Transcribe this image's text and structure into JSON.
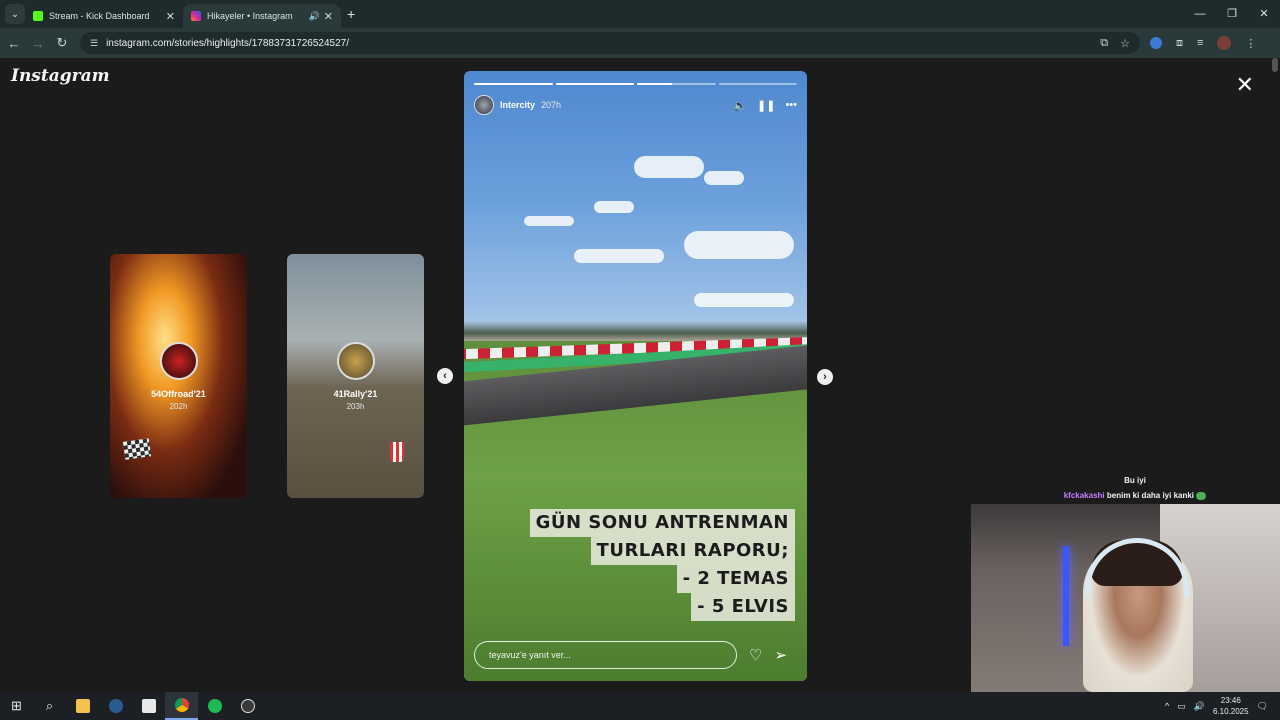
{
  "browser": {
    "tabs": [
      {
        "title": "Stream - Kick Dashboard",
        "favicon_color": "#53fc18",
        "active": false
      },
      {
        "title": "Hikayeler • Instagram",
        "favicon_color": "#d6249f",
        "active": true
      }
    ],
    "url": "instagram.com/stories/highlights/17883731726524527/",
    "window_controls": [
      "—",
      "❐",
      "✕"
    ]
  },
  "instagram": {
    "logo": "Instagram",
    "previews": [
      {
        "name": "54Offroad'21",
        "time": "202h"
      },
      {
        "name": "41Rally'21",
        "time": "203h"
      }
    ],
    "story": {
      "user": "Intercity",
      "time": "207h",
      "progress": [
        1.0,
        1.0,
        0.45,
        0.0
      ],
      "caption": [
        "GÜN SONU ANTRENMAN",
        "TURLARI RAPORU;",
        "- 2 TEMAS",
        "-   5 ELVIS"
      ],
      "reply_placeholder": "teyavuz'e yanıt ver..."
    }
  },
  "chat": [
    {
      "user": "",
      "message": "Bu iyi"
    },
    {
      "user": "kfckakashi",
      "message": "benim ki daha iyi kanki"
    }
  ],
  "taskbar": {
    "time": "23:46",
    "date": "6.10.2025"
  }
}
